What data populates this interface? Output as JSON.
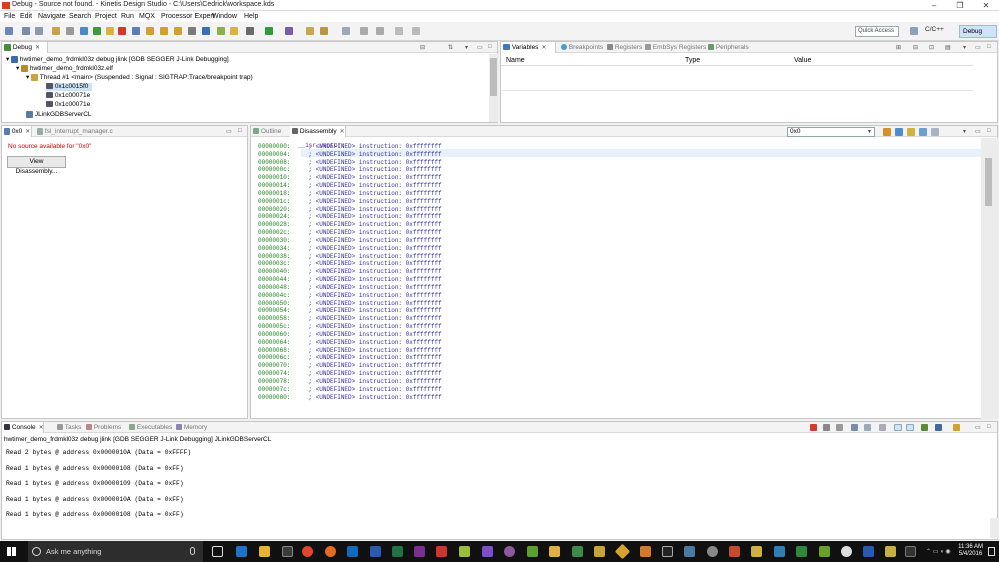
{
  "window": {
    "title": "Debug - Source not found. - Kinetis Design Studio - C:\\Users\\Cedrick\\workspace.kds"
  },
  "menu": [
    "File",
    "Edit",
    "Navigate",
    "Search",
    "Project",
    "Run",
    "MQX",
    "Processor Expert",
    "Window",
    "Help"
  ],
  "toolbar": {
    "quick_access_placeholder": "Quick Access",
    "perspective_cc": "C/C++",
    "perspective_debug": "Debug"
  },
  "debug_view": {
    "tab": "Debug",
    "tree": [
      "hwtimer_demo_frdmkl03z debug jlink [GDB SEGGER J-Link Debugging]",
      "hwtimer_demo_frdmkl03z.elf",
      "Thread #1 <main> (Suspended : Signal : SIGTRAP:Trace/breakpoint trap)",
      "0x1c0015f0",
      "0x1c00071e",
      "0x1c00071e",
      "JLinkGDBServerCL"
    ]
  },
  "variables_view": {
    "tabs": [
      "Variables",
      "Breakpoints",
      "Registers",
      "EmbSys Registers",
      "Peripherals"
    ],
    "columns": [
      "Name",
      "Type",
      "Value"
    ]
  },
  "editor": {
    "tabs": [
      "0x0",
      "fsl_interrupt_manager.c"
    ],
    "no_source": "No source available for \"0x0\"",
    "view_button": "View Disassembly..."
  },
  "disassembly": {
    "tabs": [
      "Outline",
      "Disassembly"
    ],
    "address_input": "0x0",
    "label": "__isr_vector:",
    "instruction": "; <UNDEFINED> instruction: 0xffffffff",
    "addresses": [
      "00000000:",
      "00000004:",
      "00000008:",
      "0000000c:",
      "00000010:",
      "00000014:",
      "00000018:",
      "0000001c:",
      "00000020:",
      "00000024:",
      "00000028:",
      "0000002c:",
      "00000030:",
      "00000034:",
      "00000038:",
      "0000003c:",
      "00000040:",
      "00000044:",
      "00000048:",
      "0000004c:",
      "00000050:",
      "00000054:",
      "00000058:",
      "0000005c:",
      "00000060:",
      "00000064:",
      "00000068:",
      "0000006c:",
      "00000070:",
      "00000074:",
      "00000078:",
      "0000007c:",
      "00000080:"
    ]
  },
  "console": {
    "tabs": [
      "Console",
      "Tasks",
      "Problems",
      "Executables",
      "Memory"
    ],
    "header": "hwtimer_demo_frdmkl03z debug jlink [GDB SEGGER J-Link Debugging] JLinkGDBServerCL",
    "lines": [
      "Read 2 bytes @ address 0x0000010A (Data = 0xFFFF)",
      "Read 1 bytes @ address 0x00000108 (Data = 0xFF)",
      "Read 1 bytes @ address 0x00000109 (Data = 0xFF)",
      "Read 1 bytes @ address 0x0000010A (Data = 0xFF)",
      "Read 1 bytes @ address 0x00000108 (Data = 0xFF)"
    ]
  },
  "taskbar": {
    "search_placeholder": "Ask me anything",
    "time": "11:36 AM",
    "date": "5/4/2016"
  }
}
